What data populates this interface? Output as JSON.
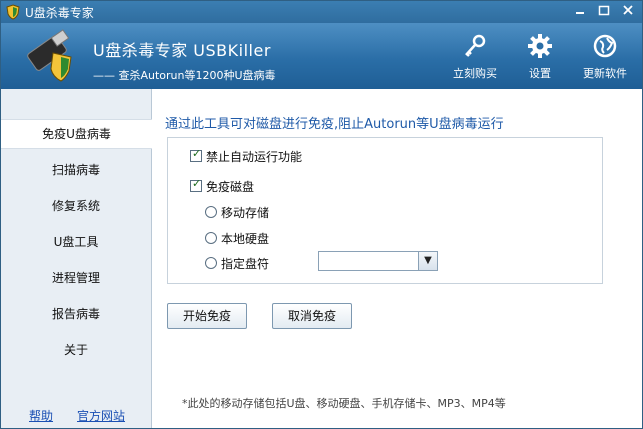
{
  "window": {
    "title": "U盘杀毒专家"
  },
  "header": {
    "app_title": "U盘杀毒专家  USBKiller",
    "subtitle": "—— 查杀Autorun等1200种U盘病毒",
    "buttons": [
      {
        "label": "立刻购买",
        "icon": "key-icon"
      },
      {
        "label": "设置",
        "icon": "gear-icon"
      },
      {
        "label": "更新软件",
        "icon": "globe-icon"
      }
    ]
  },
  "sidebar": {
    "items": [
      {
        "label": "免疫U盘病毒",
        "active": true
      },
      {
        "label": "扫描病毒"
      },
      {
        "label": "修复系统"
      },
      {
        "label": "U盘工具"
      },
      {
        "label": "进程管理"
      },
      {
        "label": "报告病毒"
      },
      {
        "label": "关于"
      }
    ],
    "footer": {
      "help": "帮助",
      "site": "官方网站"
    }
  },
  "main": {
    "headline": "通过此工具可对磁盘进行免疫,阻止Autorun等U盘病毒运行",
    "options": {
      "disable_autorun": {
        "label": "禁止自动运行功能",
        "checked": true
      },
      "immunize_disk": {
        "label": "免疫磁盘",
        "checked": true
      },
      "radios": [
        {
          "label": "移动存储",
          "selected": false
        },
        {
          "label": "本地硬盘",
          "selected": false
        },
        {
          "label": "指定盘符",
          "selected": false
        }
      ],
      "drive_select_value": ""
    },
    "buttons": {
      "start": "开始免疫",
      "cancel": "取消免疫"
    },
    "note": "*此处的移动存储包括U盘、移动硬盘、手机存储卡、MP3、MP4等"
  }
}
